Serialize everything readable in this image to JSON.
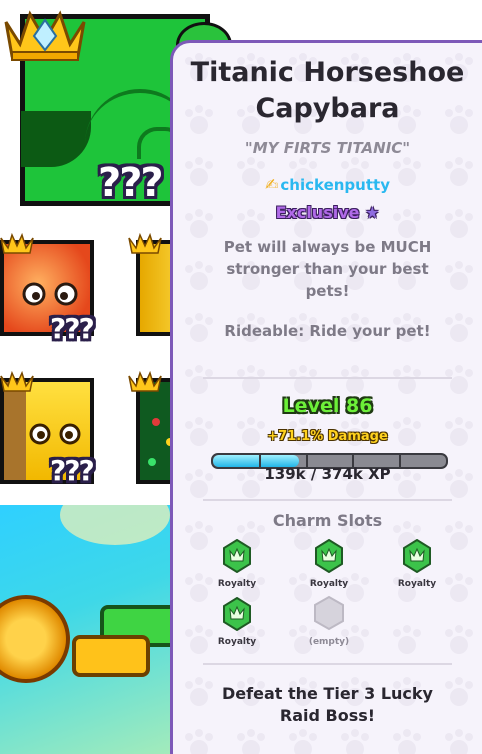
{
  "pet": {
    "name": "Titanic Horseshoe Capybara",
    "nickname": "\"MY FIRTS TITANIC\"",
    "creator": "chickenputty",
    "rarity": "Exclusive",
    "description": "Pet will always be MUCH stronger than your best pets!",
    "ability": "Rideable: Ride your pet!",
    "level_label": "Level 86",
    "damage_bonus": "+71.1% Damage",
    "xp_text": "139k / 374k XP",
    "xp_progress": 0.37,
    "obtain_text": "Defeat the Tier 3 Lucky Raid Boss!"
  },
  "charms": {
    "title": "Charm Slots",
    "slots": [
      {
        "label": "Royalty",
        "icon": "royalty-charm-icon",
        "filled": true
      },
      {
        "label": "Royalty",
        "icon": "royalty-charm-icon",
        "filled": true
      },
      {
        "label": "Royalty",
        "icon": "royalty-charm-icon",
        "filled": true
      },
      {
        "label": "Royalty",
        "icon": "royalty-charm-icon",
        "filled": true
      },
      {
        "label": "(empty)",
        "icon": "empty-slot-icon",
        "filled": false
      }
    ]
  },
  "background_grid": {
    "hidden_marker": "???",
    "tiles": [
      {
        "icon": "green-capybara-pet-icon",
        "badge": "crown-icon"
      },
      {
        "icon": "orange-cat-pet-icon",
        "badge": "crown-icon"
      },
      {
        "icon": "yellow-pet-icon",
        "badge": "crown-icon"
      },
      {
        "icon": "yellow-dog-pet-icon",
        "badge": "crown-icon"
      },
      {
        "icon": "green-pet-icon",
        "badge": "crown-icon"
      }
    ]
  },
  "colors": {
    "panel_border": "#7d59b8",
    "panel_bg": "#f6f3fb",
    "level_green": "#6cf038",
    "damage_yellow": "#ffd21e",
    "creator_blue": "#2ab8f0",
    "exclusive_purple": "#b06ae8",
    "xp_fill": "#22b6e8"
  }
}
